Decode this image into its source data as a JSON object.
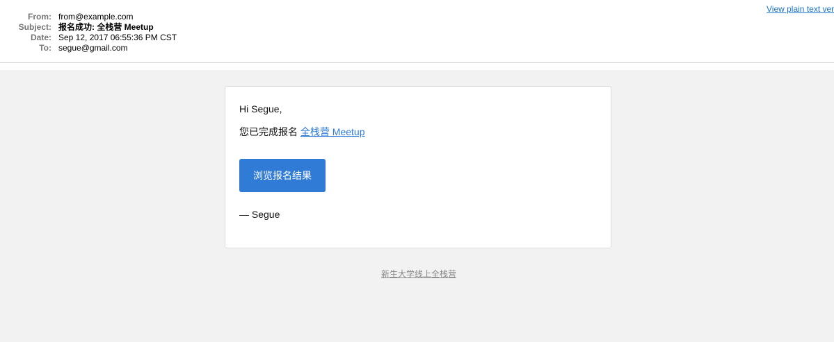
{
  "header": {
    "from_label": "From:",
    "from_value": "from@example.com",
    "subject_label": "Subject:",
    "subject_value": "报名成功: 全栈营 Meetup",
    "date_label": "Date:",
    "date_value": "Sep 12, 2017 06:55:36 PM CST",
    "to_label": "To:",
    "to_value": "segue@gmail.com",
    "plain_text_link": "View plain text version"
  },
  "email": {
    "greeting": "Hi Segue,",
    "body_prefix": "您已完成报名 ",
    "event_link": "全栈营 Meetup",
    "cta_label": "浏览报名结果",
    "signature": "— Segue"
  },
  "footer": {
    "org_link": "新生大学线上全栈营"
  },
  "colors": {
    "accent": "#2f7bd6",
    "link": "#1a73c9",
    "background": "#f2f2f2"
  }
}
